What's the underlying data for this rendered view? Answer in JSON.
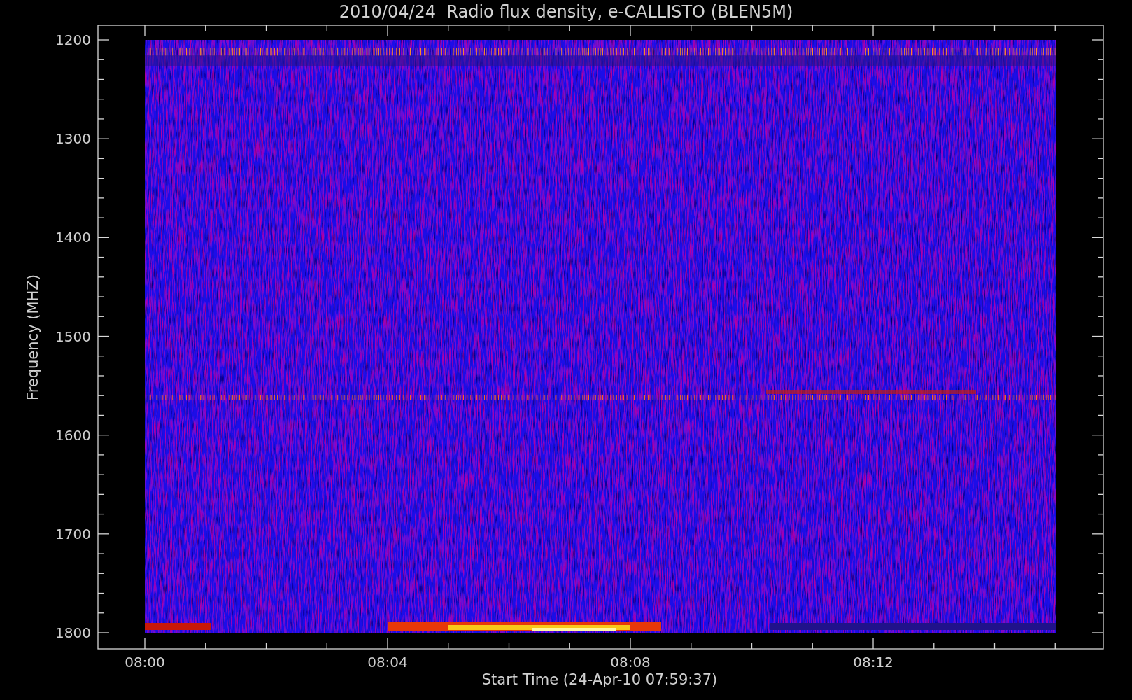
{
  "title": "2010/04/24  Radio flux density, e-CALLISTO (BLEN5M)",
  "y_axis": {
    "label": "Frequency (MHZ)",
    "ticks": [
      "1200",
      "1300",
      "1400",
      "1500",
      "1600",
      "1700",
      "1800"
    ]
  },
  "x_axis": {
    "label": "Start Time (24-Apr-10 07:59:37)",
    "ticks": [
      "08:00",
      "08:04",
      "08:08",
      "08:12"
    ]
  }
}
